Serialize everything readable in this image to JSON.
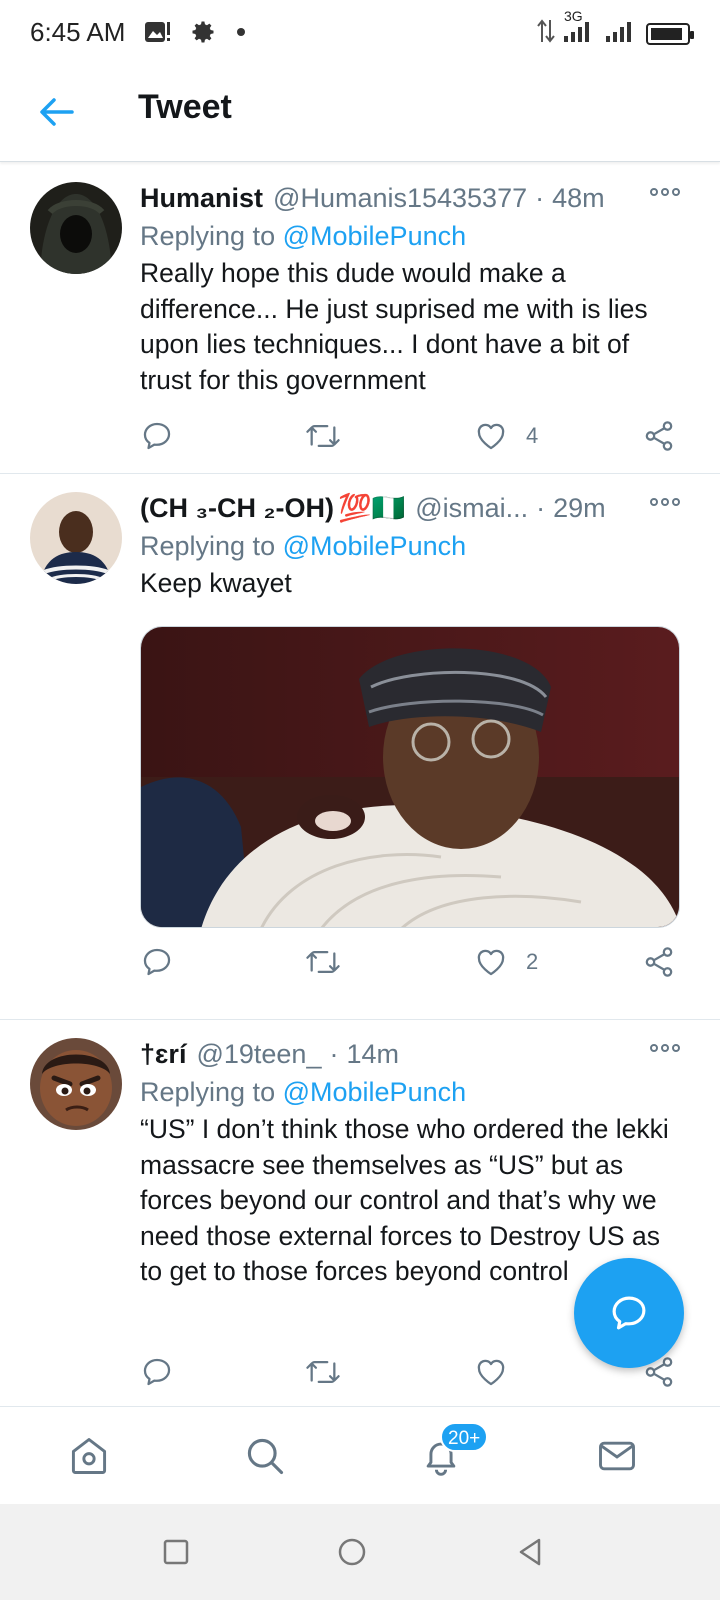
{
  "status_bar": {
    "time": "6:45 AM",
    "network_label": "3G",
    "battery_level": 0.9
  },
  "header": {
    "title": "Tweet"
  },
  "tweets": [
    {
      "name": "Humanist",
      "handle": "@Humanis15435377",
      "separator": "·",
      "time": "48m",
      "replying_prefix": "Replying to",
      "replying_to": "@MobilePunch",
      "text": "Really hope this dude would make a difference... He just suprised me with is lies upon lies techniques... I dont have a bit of trust for this government",
      "likes": "4"
    },
    {
      "name": "(CH ₃-CH ₂-OH)",
      "name_emoji": "💯🇳🇬",
      "handle": "@ismai...",
      "separator": "·",
      "time": "29m",
      "replying_prefix": "Replying to",
      "replying_to": "@MobilePunch",
      "text": "Keep kwayet",
      "likes": "2"
    },
    {
      "name": "†ɛrí",
      "handle": "@19teen_",
      "separator": "·",
      "time": "14m",
      "replying_prefix": "Replying to",
      "replying_to": "@MobilePunch",
      "text": "“US” I don’t think those who ordered the lekki massacre see themselves as “US” but as forces beyond our control and that’s why we need those external forces to Destroy US as to get to those forces beyond control",
      "likes": ""
    }
  ],
  "bottom_nav": {
    "items": [
      "home-icon",
      "search-icon",
      "notifications-icon",
      "messages-icon"
    ],
    "notification_badge": "20+"
  },
  "colors": {
    "accent": "#1da1f2",
    "text": "#14171a",
    "secondary": "#657786"
  }
}
